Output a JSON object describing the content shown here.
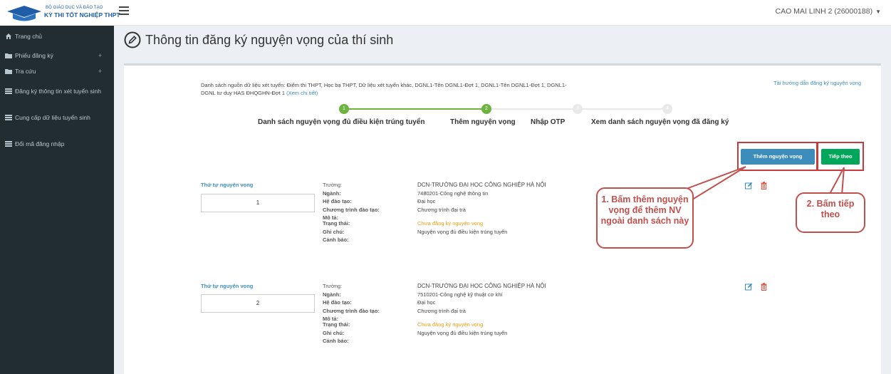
{
  "header": {
    "logo_line1": "BỘ GIÁO DỤC VÀ ĐÀO TẠO",
    "logo_line2": "KỲ THI TỐT NGHIỆP THPT",
    "user": "CAO MAI LINH 2 (26000188)"
  },
  "sidebar": {
    "items": [
      {
        "label": "Trang chủ",
        "icon": "home-icon"
      },
      {
        "label": "Phiếu đăng ký",
        "icon": "folder-icon",
        "expand": "+"
      },
      {
        "label": "Tra cứu",
        "icon": "folder-icon",
        "expand": "+"
      },
      {
        "label": "Đăng ký thông tin xét tuyển sinh",
        "icon": "list-icon"
      },
      {
        "label": "Cung cấp dữ liệu tuyển sinh",
        "icon": "list-icon"
      },
      {
        "label": "Đổi mã đăng nhập",
        "icon": "list-icon"
      }
    ]
  },
  "page": {
    "title": "Thông tin đăng ký nguyện vọng của thí sinh",
    "sources_text": "Danh sách nguồn dữ liệu xét tuyển: Điểm thi THPT, Học bạ THPT, Dữ liệu xét tuyển khác, DGNL1-Tên DGNL1-Đợt 1, DGNL1-Tên DGNL1-Đợt 1, DGNL1-DGNL tư duy HAS ĐHQGHN-Đợt 1",
    "sources_link": "(Xem chi tiết)",
    "guide_link": "Tải hướng dẫn đăng ký nguyện vọng"
  },
  "stepper": {
    "steps": [
      {
        "num": "1",
        "label": "Danh sách nguyện vọng đủ điều kiện trúng tuyển"
      },
      {
        "num": "2",
        "label": "Thêm nguyện vọng"
      },
      {
        "num": "3",
        "label": "Nhập OTP"
      },
      {
        "num": "4",
        "label": "Xem danh sách nguyện vọng đã đăng ký"
      }
    ]
  },
  "buttons": {
    "add": "Thêm nguyện vọng",
    "next": "Tiếp theo"
  },
  "callouts": {
    "c1": "1. Bấm thêm nguyện vọng để thêm NV ngoài danh sách này",
    "c2": "2. Bấm tiếp theo"
  },
  "field_labels": {
    "order": "Thứ tự nguyện vọng",
    "school": "Trường:",
    "major": "Ngành:",
    "level": "Hệ đào tạo:",
    "program": "Chương trình đào tạo:",
    "desc": "Mô tả:",
    "status": "Trạng thái:",
    "note": "Ghi chú:",
    "warning": "Cảnh báo:"
  },
  "records": [
    {
      "order": "1",
      "school": "DCN-TRƯỜNG ĐẠI HỌC CÔNG NGHIỆP HÀ NỘI",
      "major": "7480201-Công nghệ thông tin",
      "level": "Đại học",
      "program": "Chương trình đại trà",
      "desc": "",
      "status": "Chưa đăng ký nguyện vọng",
      "note": "Nguyện vọng đủ điều kiện trúng tuyển",
      "warning": ""
    },
    {
      "order": "2",
      "school": "DCN-TRƯỜNG ĐẠI HỌC CÔNG NGHIỆP HÀ NỘI",
      "major": "7510201-Công nghệ kỹ thuật cơ khí",
      "level": "Đại học",
      "program": "Chương trình đại trà",
      "desc": "",
      "status": "Chưa đăng ký nguyện vọng",
      "note": "Nguyện vọng đủ điều kiện trúng tuyển",
      "warning": ""
    }
  ],
  "colors": {
    "brand": "#1f5da8",
    "sidebar_bg": "#222d32",
    "primary": "#3c8dbc",
    "success": "#00a65a",
    "step_done": "#6db33f",
    "callout": "#c0504d",
    "status": "#f39c12"
  }
}
